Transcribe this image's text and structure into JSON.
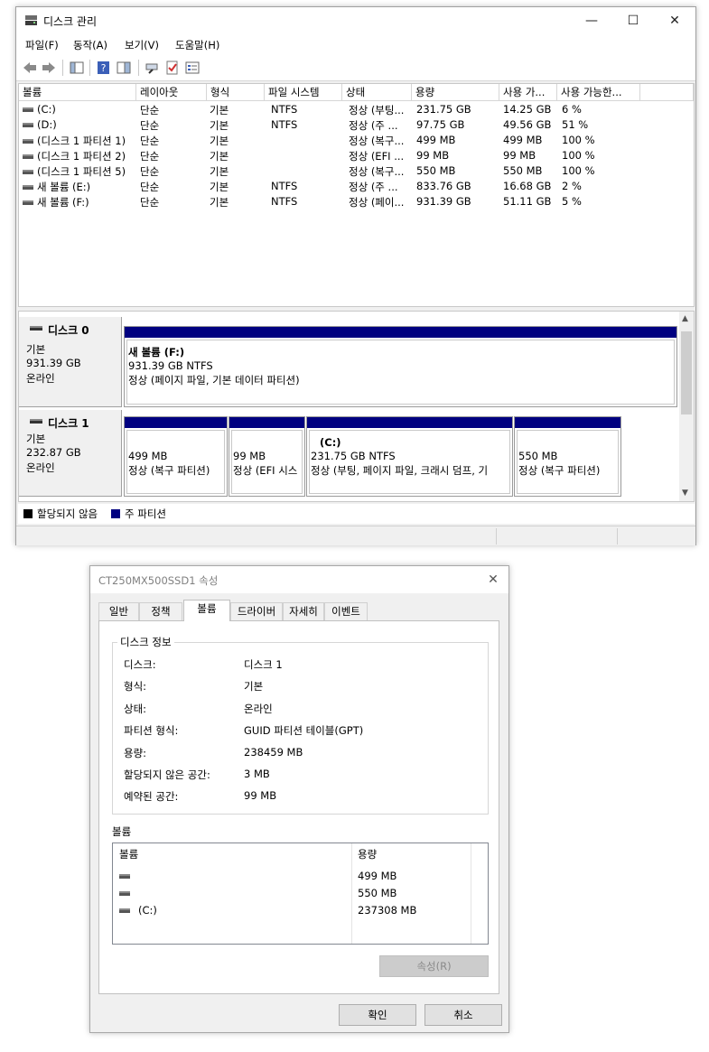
{
  "main": {
    "title": "디스크 관리",
    "menu": [
      "파일(F)",
      "동작(A)",
      "보기(V)",
      "도움말(H)"
    ],
    "toolbar_icons": [
      "back-icon",
      "forward-icon",
      "console-tree-icon",
      "help-icon",
      "action-pane-icon",
      "connect-icon",
      "check-icon",
      "properties-icon"
    ],
    "columns": [
      "볼륨",
      "레이아웃",
      "형식",
      "파일 시스템",
      "상태",
      "용량",
      "사용 가...",
      "사용 가능한..."
    ],
    "rows": [
      [
        "(C:)",
        "단순",
        "기본",
        "NTFS",
        "정상 (부팅...",
        "231.75 GB",
        "14.25 GB",
        "6 %"
      ],
      [
        "(D:)",
        "단순",
        "기본",
        "NTFS",
        "정상 (주 ...",
        "97.75 GB",
        "49.56 GB",
        "51 %"
      ],
      [
        "(디스크 1 파티션 1)",
        "단순",
        "기본",
        "",
        "정상 (복구...",
        "499 MB",
        "499 MB",
        "100 %"
      ],
      [
        "(디스크 1 파티션 2)",
        "단순",
        "기본",
        "",
        "정상 (EFI ...",
        "99 MB",
        "99 MB",
        "100 %"
      ],
      [
        "(디스크 1 파티션 5)",
        "단순",
        "기본",
        "",
        "정상 (복구...",
        "550 MB",
        "550 MB",
        "100 %"
      ],
      [
        "새 볼륨 (E:)",
        "단순",
        "기본",
        "NTFS",
        "정상 (주 ...",
        "833.76 GB",
        "16.68 GB",
        "2 %"
      ],
      [
        "새 볼륨 (F:)",
        "단순",
        "기본",
        "NTFS",
        "정상 (페이...",
        "931.39 GB",
        "51.11 GB",
        "5 %"
      ]
    ],
    "disk0": {
      "name": "디스크 0",
      "type": "기본",
      "size": "931.39 GB",
      "state": "온라인",
      "partition": {
        "name": "새 볼륨  (F:)",
        "size": "931.39 GB NTFS",
        "status": "정상 (페이지 파일, 기본 데이터 파티션)"
      }
    },
    "disk1": {
      "name": "디스크 1",
      "type": "기본",
      "size": "232.87 GB",
      "state": "온라인",
      "partitions": [
        {
          "name": "",
          "size": "499 MB",
          "status": "정상 (복구 파티션)"
        },
        {
          "name": "",
          "size": "99 MB",
          "status": "정상 (EFI 시스"
        },
        {
          "name": "(C:)",
          "size": "231.75 GB NTFS",
          "status": "정상 (부팅, 페이지 파일, 크래시 덤프, 기"
        },
        {
          "name": "",
          "size": "550 MB",
          "status": "정상 (복구 파티션)"
        }
      ]
    },
    "legend": {
      "unallocated": "할당되지 않음",
      "primary": "주 파티션"
    },
    "colors": {
      "primary": "#000080",
      "unallocated": "#000000"
    }
  },
  "dialog": {
    "title": "CT250MX500SSD1 속성",
    "tabs": [
      "일반",
      "정책",
      "볼륨",
      "드라이버",
      "자세히",
      "이벤트"
    ],
    "group_disk_info": "디스크 정보",
    "props": [
      {
        "label": "디스크:",
        "value": "디스크 1"
      },
      {
        "label": "형식:",
        "value": "기본"
      },
      {
        "label": "상태:",
        "value": "온라인"
      },
      {
        "label": "파티션 형식:",
        "value": "GUID 파티션 테이블(GPT)"
      },
      {
        "label": "용량:",
        "value": "238459 MB"
      },
      {
        "label": "할당되지 않은 공간:",
        "value": "3 MB"
      },
      {
        "label": "예약된 공간:",
        "value": "99 MB"
      }
    ],
    "volumes_label": "볼륨",
    "vol_columns": [
      "볼륨",
      "용량"
    ],
    "volumes": [
      {
        "name": "",
        "size": "499 MB"
      },
      {
        "name": "",
        "size": "550 MB"
      },
      {
        "name": "(C:)",
        "size": "237308 MB"
      }
    ],
    "properties_button": "속성(R)",
    "ok_button": "확인",
    "cancel_button": "취소"
  }
}
